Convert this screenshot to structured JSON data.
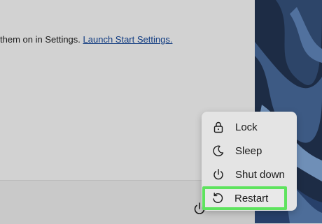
{
  "settings_notice": {
    "text": "them on in Settings.",
    "link_label": "Launch Start Settings."
  },
  "footer": {
    "power_icon": "power-icon"
  },
  "power_menu": {
    "items": [
      {
        "label": "Lock",
        "icon": "lock-icon"
      },
      {
        "label": "Sleep",
        "icon": "moon-icon"
      },
      {
        "label": "Shut down",
        "icon": "power-icon"
      },
      {
        "label": "Restart",
        "icon": "restart-icon",
        "highlighted": true
      }
    ]
  },
  "colors": {
    "highlight": "#5ee35e",
    "link": "#0f3a80",
    "wallpaper": "#1d2c45"
  }
}
